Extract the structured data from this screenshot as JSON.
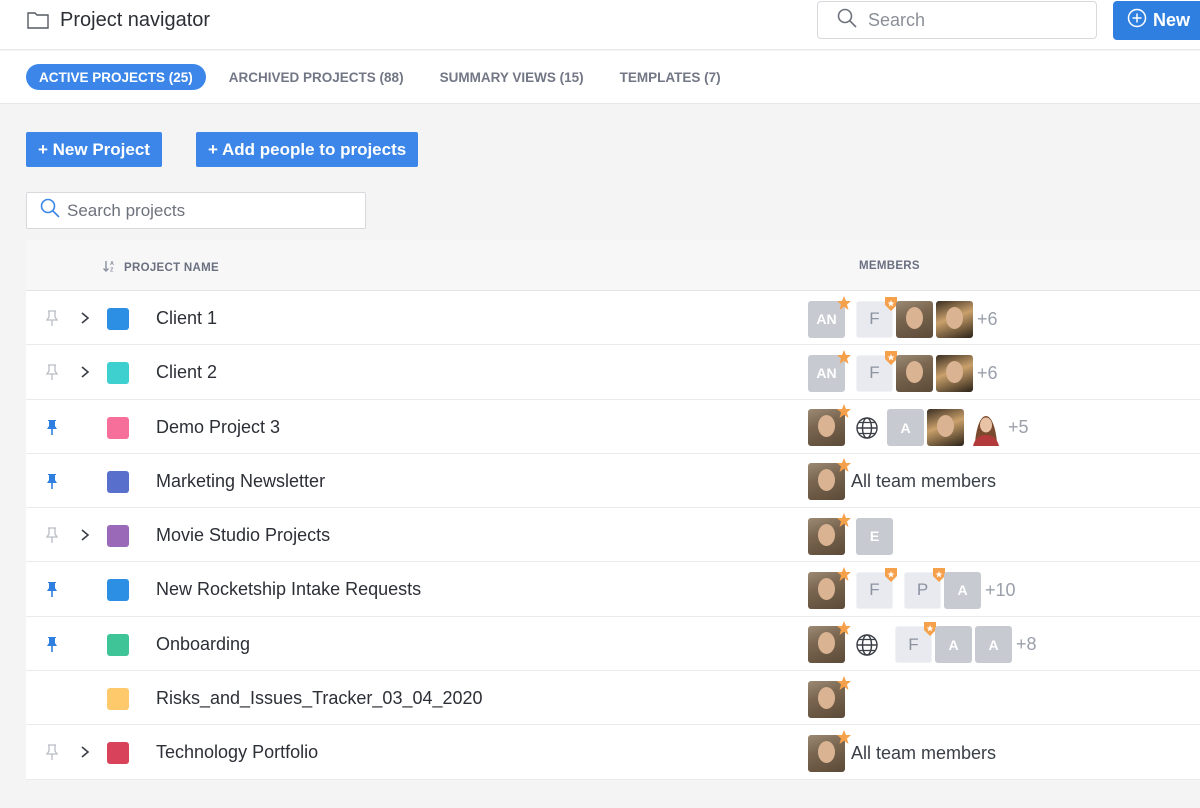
{
  "header": {
    "title": "Project navigator",
    "search_placeholder": "Search",
    "new_label": "New"
  },
  "tabs": [
    {
      "label": "ACTIVE PROJECTS (25)",
      "active": true
    },
    {
      "label": "ARCHIVED PROJECTS (88)",
      "active": false
    },
    {
      "label": "SUMMARY VIEWS (15)",
      "active": false
    },
    {
      "label": "TEMPLATES (7)",
      "active": false
    }
  ],
  "actions": {
    "new_project": "+ New Project",
    "add_people": "+ Add people to projects"
  },
  "project_search": {
    "placeholder": "Search projects"
  },
  "table": {
    "col_name": "PROJECT NAME",
    "col_members": "MEMBERS"
  },
  "projects": [
    {
      "name": "Client 1",
      "color": "#2d8fe3",
      "pinned": false,
      "expandable": true
    },
    {
      "name": "Client 2",
      "color": "#3ecfcf",
      "pinned": false,
      "expandable": true
    },
    {
      "name": "Demo Project 3",
      "color": "#f56f9a",
      "pinned": true,
      "expandable": false
    },
    {
      "name": "Marketing Newsletter",
      "color": "#5870cc",
      "pinned": true,
      "expandable": false
    },
    {
      "name": "Movie Studio Projects",
      "color": "#9a69b8",
      "pinned": false,
      "expandable": true
    },
    {
      "name": "New Rocketship Intake Requests",
      "color": "#2d8fe3",
      "pinned": true,
      "expandable": false
    },
    {
      "name": "Onboarding",
      "color": "#3ec496",
      "pinned": true,
      "expandable": false
    },
    {
      "name": "Risks_and_Issues_Tracker_03_04_2020",
      "color": "#fdc96b",
      "pinned": false,
      "expandable": false
    },
    {
      "name": "Technology Portfolio",
      "color": "#d8435b",
      "pinned": false,
      "expandable": true
    }
  ],
  "members": {
    "r0": {
      "a1": "AN",
      "a2": "F",
      "more": "+6"
    },
    "r1": {
      "a1": "AN",
      "a2": "F",
      "more": "+6"
    },
    "r2": {
      "a1": "A",
      "more": "+5"
    },
    "r3": {
      "all": "All team members"
    },
    "r4": {
      "a1": "E"
    },
    "r5": {
      "a1": "F",
      "a2": "P",
      "a3": "A",
      "more": "+10"
    },
    "r6": {
      "a1": "F",
      "a2": "A",
      "a3": "A",
      "more": "+8"
    },
    "r8": {
      "all": "All team members"
    }
  },
  "colors": {
    "accent": "#3b86e8",
    "pin_active": "#2f7fe0",
    "star": "#f5a04a"
  }
}
